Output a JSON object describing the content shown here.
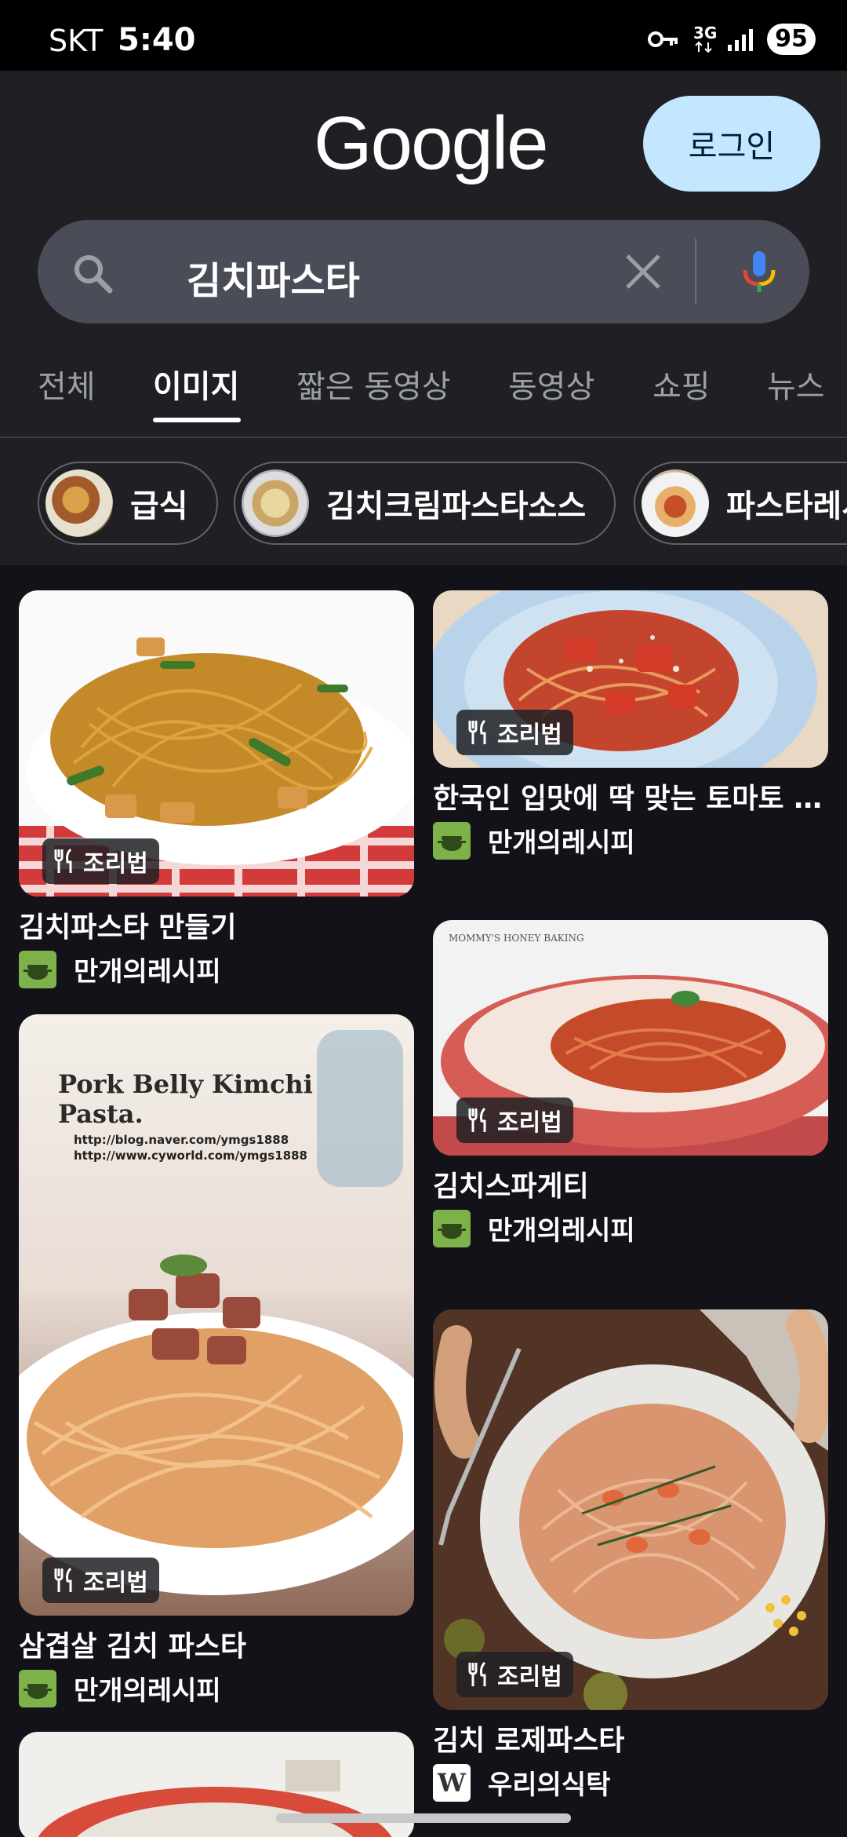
{
  "status_bar": {
    "carrier": "SKT",
    "time": "5:40",
    "network": "3G",
    "battery": "95"
  },
  "header": {
    "logo": "Google",
    "login_label": "로그인"
  },
  "search": {
    "query": "김치파스타"
  },
  "tabs": [
    {
      "label": "전체"
    },
    {
      "label": "이미지",
      "active": true
    },
    {
      "label": "짧은 동영상"
    },
    {
      "label": "동영상"
    },
    {
      "label": "쇼핑"
    },
    {
      "label": "뉴스"
    }
  ],
  "chips": [
    {
      "label": "급식"
    },
    {
      "label": "김치크림파스타소스"
    },
    {
      "label": "파스타레시"
    }
  ],
  "results": [
    {
      "title": "김치파스타 만들기",
      "source": "만개의레시피",
      "badge": "조리법"
    },
    {
      "title": "한국인 입맛에 딱 맞는 토마토 김...",
      "source": "만개의레시피",
      "badge": "조리법"
    },
    {
      "title": "김치스파게티",
      "source": "만개의레시피",
      "badge": "조리법",
      "image_caption": "MOMMY'S HONEY BAKING"
    },
    {
      "title": "삼겹살 김치 파스타",
      "source": "만개의레시피",
      "badge": "조리법",
      "image_caption": "Pork Belly Kimchi Pasta.",
      "image_urls": "http://blog.naver.com/ymgs1888 http://www.cyworld.com/ymgs1888"
    },
    {
      "title": "김치 로제파스타",
      "source": "우리의식탁",
      "badge": "조리법",
      "source_logo_letter": "W"
    }
  ],
  "colors": {
    "background": "#1f1f24",
    "grid_background": "#121218",
    "login_button": "#c2e7ff",
    "source_logo_green": "#7db24a"
  }
}
